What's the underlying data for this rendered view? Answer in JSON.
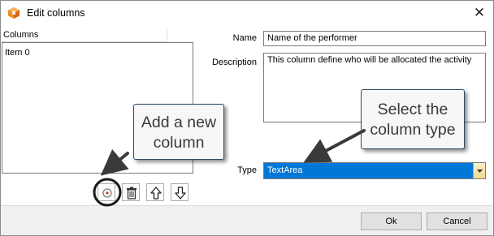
{
  "window": {
    "title": "Edit columns",
    "close_glyph": "✕",
    "icon": "app-cube-icon"
  },
  "left_pane": {
    "header": "Columns",
    "items": [
      "Item 0"
    ],
    "toolbar": {
      "add_icon": "add-circle-icon",
      "delete_icon": "trash-icon",
      "up_icon": "arrow-up-icon",
      "down_icon": "arrow-down-icon"
    }
  },
  "form": {
    "name_label": "Name",
    "name_value": "Name of the performer",
    "description_label": "Description",
    "description_value": "This column define who will be allocated the activity",
    "type_label": "Type",
    "type_value": "TextArea",
    "dropdown_icon": "chevron-down-icon"
  },
  "footer": {
    "ok_label": "Ok",
    "cancel_label": "Cancel"
  },
  "callouts": {
    "add": [
      "Add a new",
      "column"
    ],
    "type": [
      "Select the",
      "column type"
    ]
  },
  "colors": {
    "selection": "#0078d7",
    "callout_border": "#2e4b68",
    "highlight_circle": "#1a1a1a",
    "app_icon": "#f08a24"
  }
}
